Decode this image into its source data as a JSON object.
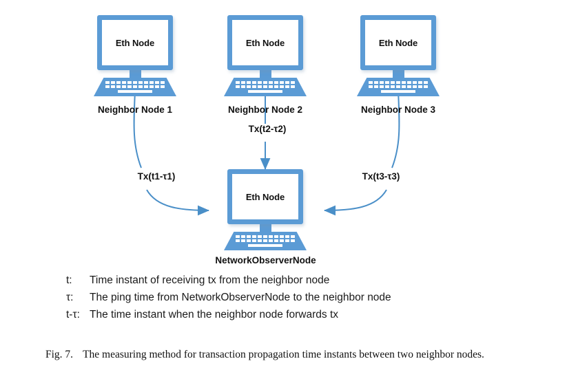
{
  "figure": {
    "number": "Fig. 7.",
    "caption": "The measuring method for transaction propagation time instants between two neighbor nodes."
  },
  "diagram": {
    "accent_color": "#5b9bd5",
    "text_color": "#111111",
    "background": "#ffffff",
    "nodes": [
      {
        "id": "neighbor1",
        "screen_label": "Eth Node",
        "caption": "Neighbor Node 1",
        "role": "neighbor"
      },
      {
        "id": "neighbor2",
        "screen_label": "Eth Node",
        "caption": "Neighbor Node 2",
        "role": "neighbor"
      },
      {
        "id": "neighbor3",
        "screen_label": "Eth Node",
        "caption": "Neighbor Node 3",
        "role": "neighbor"
      },
      {
        "id": "observer",
        "screen_label": "Eth Node",
        "caption": "NetworkObserverNode",
        "role": "observer"
      }
    ],
    "edges": [
      {
        "id": "edge1",
        "from": "neighbor1",
        "to": "observer",
        "label": "Tx(t1-τ1)"
      },
      {
        "id": "edge2",
        "from": "neighbor2",
        "to": "observer",
        "label": "Tx(t2-τ2)"
      },
      {
        "id": "edge3",
        "from": "neighbor3",
        "to": "observer",
        "label": "Tx(t3-τ3)"
      }
    ]
  },
  "legend": [
    {
      "symbol": "t:",
      "description": "Time instant of receiving tx from the neighbor node"
    },
    {
      "symbol": "τ:",
      "description": "The ping time from NetworkObserverNode to the neighbor node"
    },
    {
      "symbol": "t-τ:",
      "description": "The time instant when the neighbor node forwards tx"
    }
  ]
}
